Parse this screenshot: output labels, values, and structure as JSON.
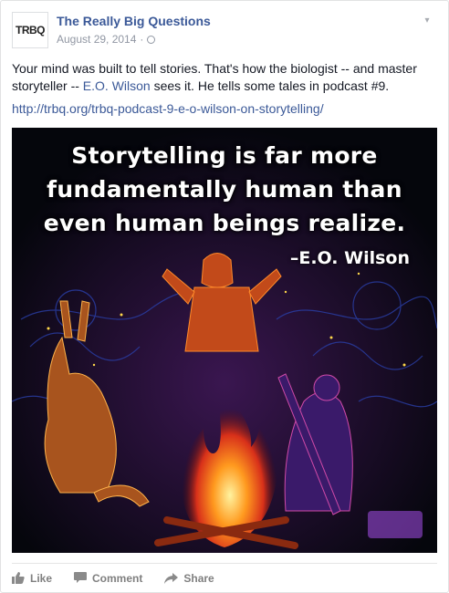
{
  "post": {
    "page_name": "The Really Big Questions",
    "avatar_text": "TRBQ",
    "date": "August 29, 2014",
    "separator": "·",
    "privacy_icon": "globe-icon",
    "text_before_link": "Your mind was built to tell stories. That's how the biologist -- and master storyteller -- ",
    "mention": "E.O. Wilson",
    "text_after_link": " sees it. He tells some tales in podcast #9.",
    "url": "http://trbq.org/trbq-podcast-9-e-o-wilson-on-storytelling/"
  },
  "image": {
    "quote": "Storytelling is far more fundamentally human than even human beings realize.",
    "attribution": "–E.O. Wilson"
  },
  "actions": {
    "like": "Like",
    "comment": "Comment",
    "share": "Share"
  },
  "colors": {
    "link": "#3b5998",
    "meta": "#9197a3",
    "action": "#7f7f7f"
  }
}
